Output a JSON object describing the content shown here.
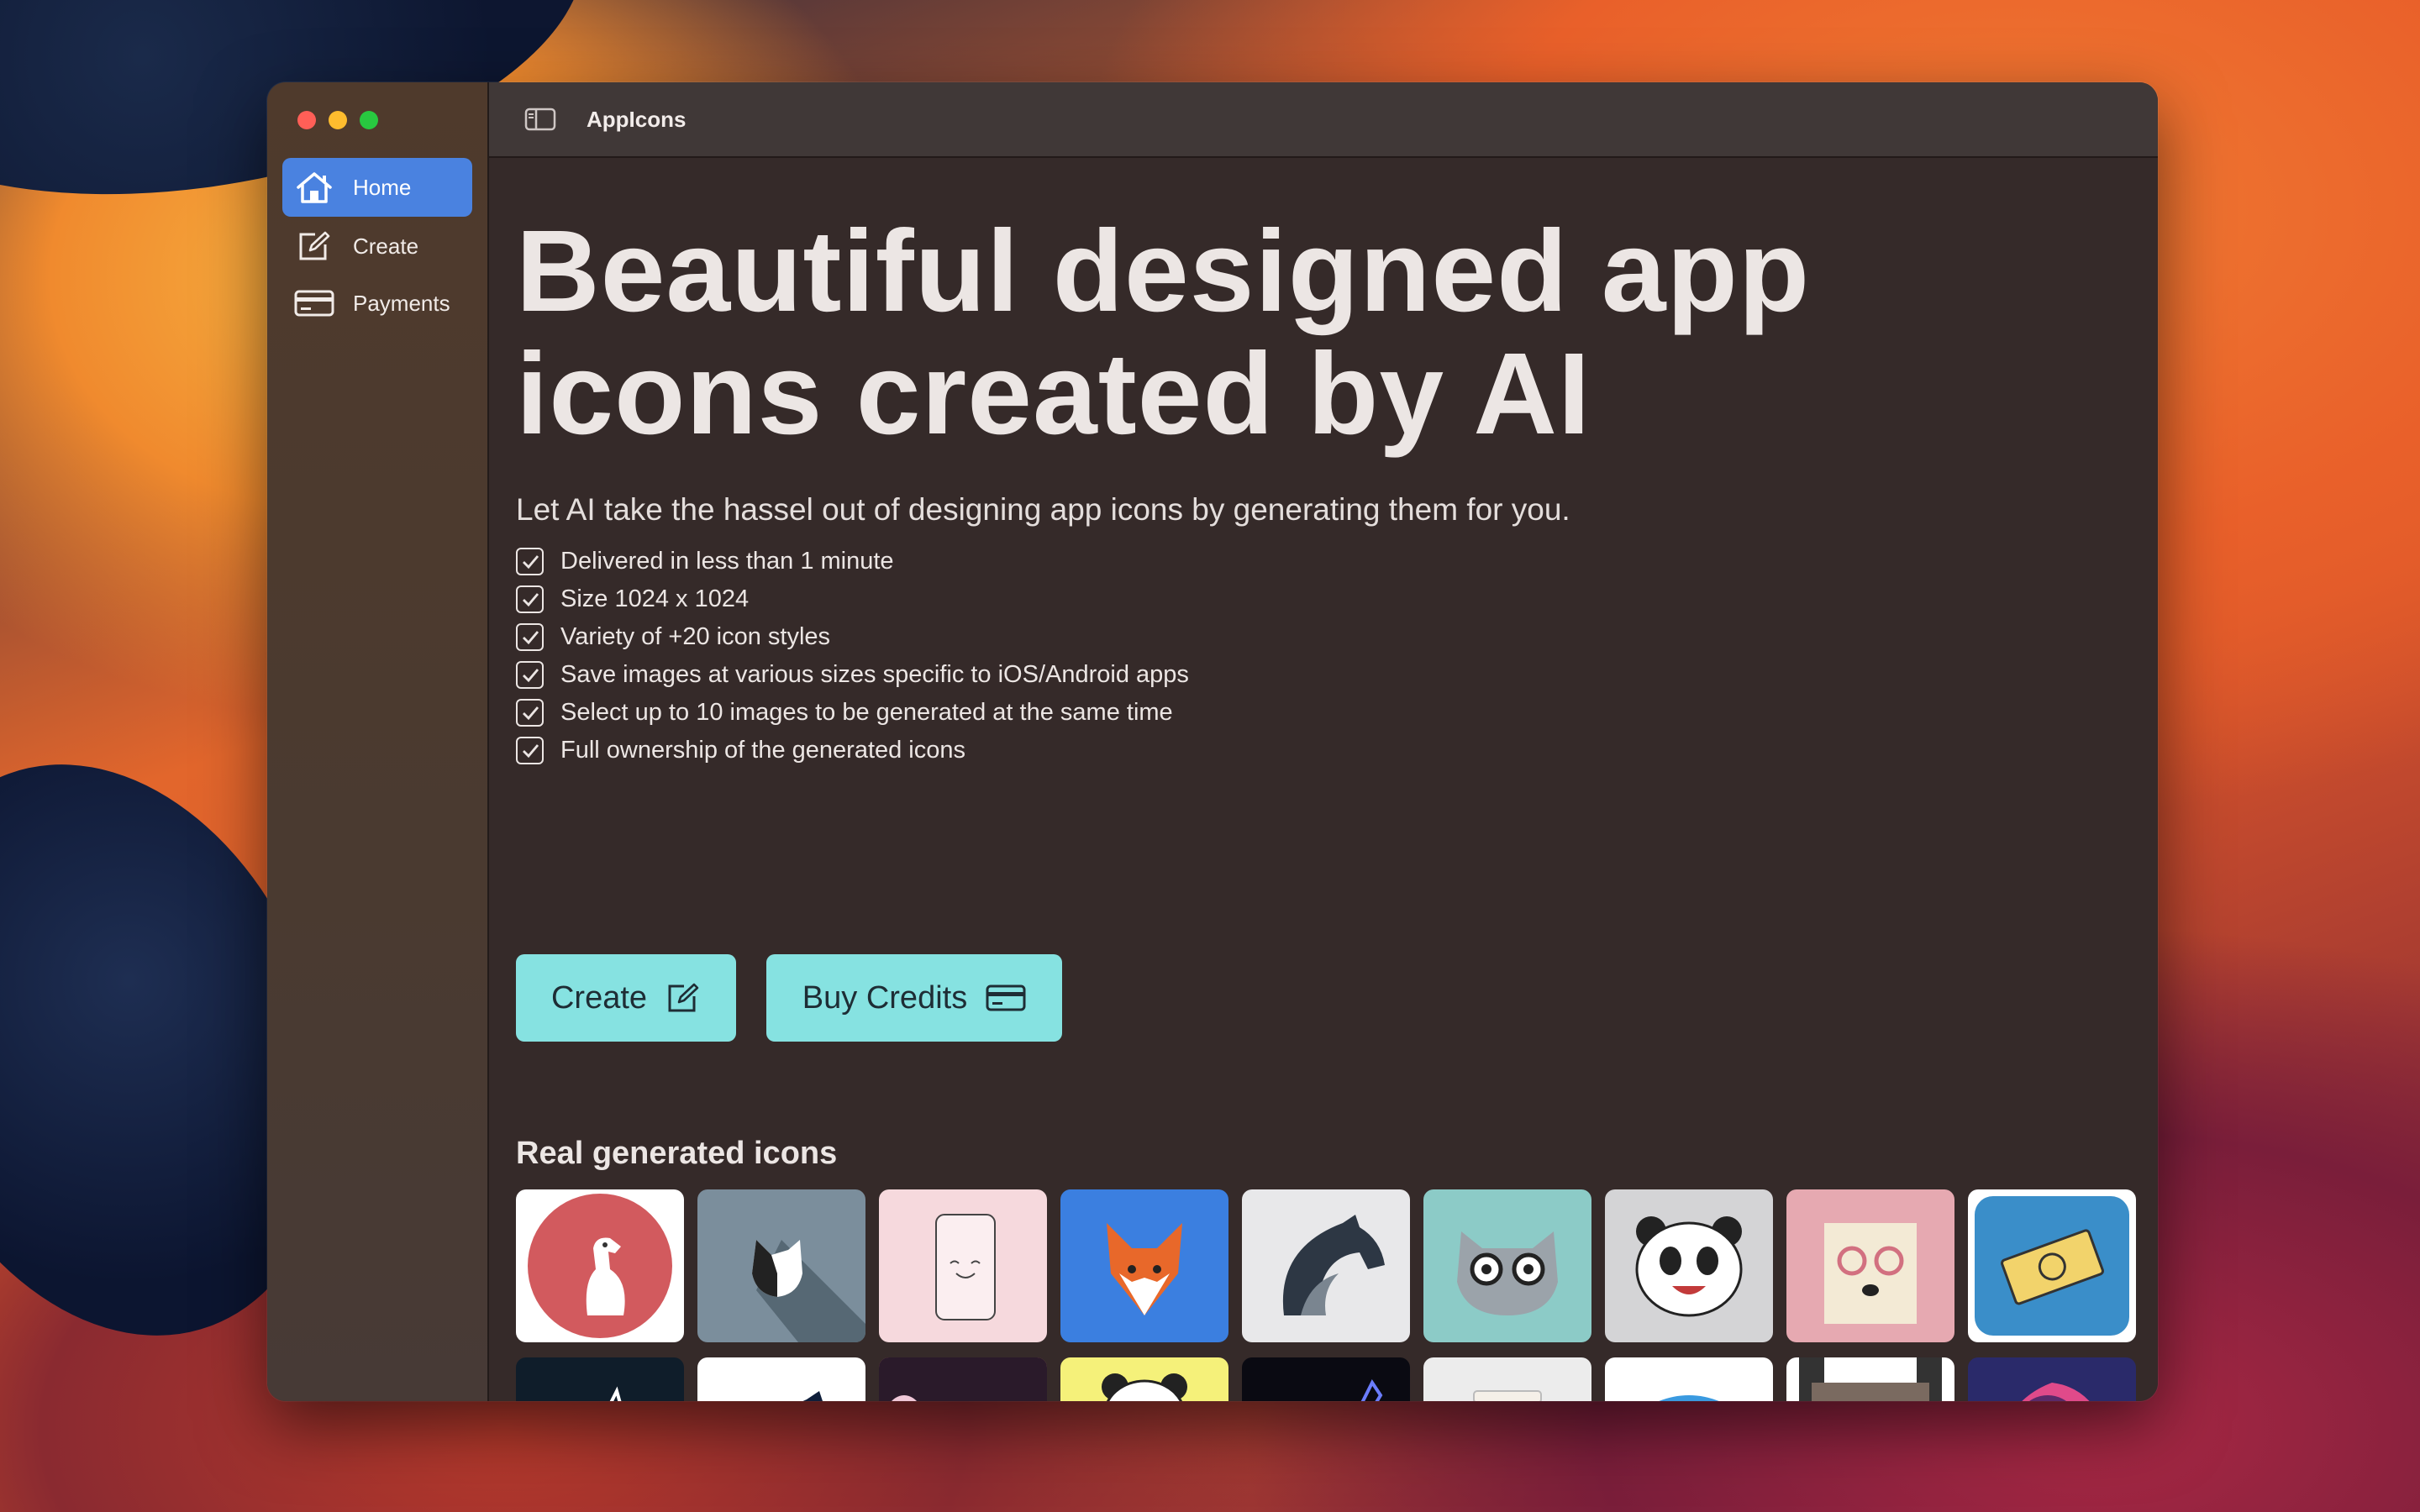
{
  "window": {
    "title": "AppIcons"
  },
  "sidebar": {
    "items": [
      {
        "label": "Home",
        "icon": "house-icon",
        "active": true
      },
      {
        "label": "Create",
        "icon": "pencil-square-icon",
        "active": false
      },
      {
        "label": "Payments",
        "icon": "credit-card-icon",
        "active": false
      }
    ]
  },
  "main": {
    "headline": "Beautiful designed app icons created by AI",
    "subtitle": "Let AI take the hassel out of designing app icons by generating them for you.",
    "features": [
      "Delivered in less than 1 minute",
      "Size 1024 x 1024",
      "Variety of +20 icon styles",
      "Save images at various sizes specific to iOS/Android apps",
      "Select up to 10 images to be generated at the same time",
      "Full ownership of the generated icons"
    ],
    "buttons": {
      "create_label": "Create",
      "buy_label": "Buy Credits"
    },
    "gallery_title": "Real generated icons",
    "gallery_icons": [
      "dog",
      "cat-shadow",
      "phone-face",
      "fox",
      "horse-swoosh",
      "cat-glasses",
      "panda-face",
      "dog-glasses",
      "money",
      "wolf-outline",
      "horse-head",
      "person-headphones",
      "panda-sitting",
      "neon-horse",
      "coffee-cup",
      "pizza",
      "pixel-husky",
      "woman-headphones"
    ]
  },
  "colors": {
    "accent_blue": "#4a82e0",
    "button_cyan": "#86e2e1",
    "window_bg": "#352a29"
  }
}
